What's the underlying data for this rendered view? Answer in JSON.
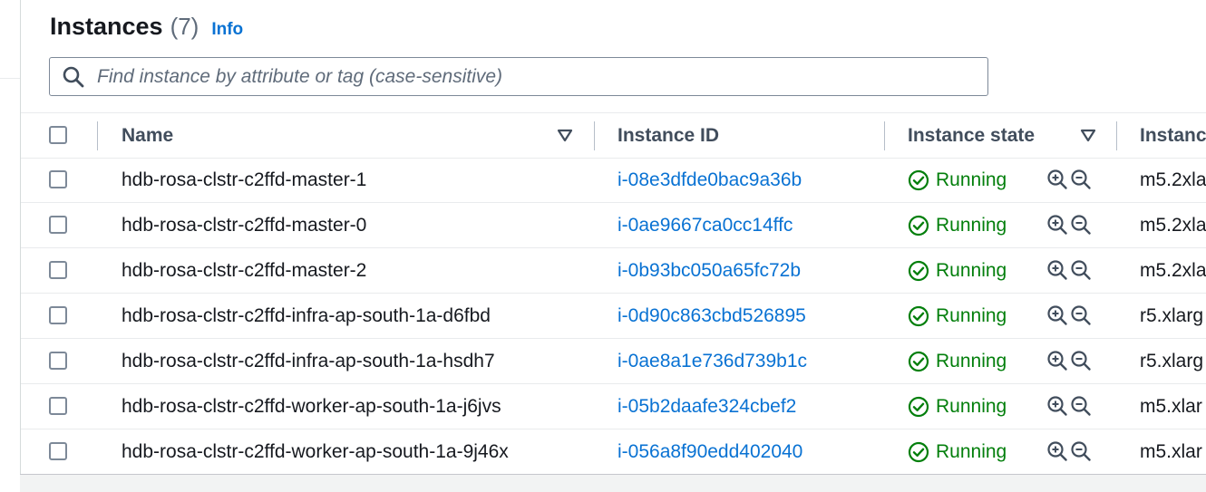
{
  "header": {
    "title": "Instances",
    "count": "(7)",
    "info_link": "Info"
  },
  "search": {
    "placeholder": "Find instance by attribute or tag (case-sensitive)"
  },
  "columns": {
    "name": "Name",
    "instance_id": "Instance ID",
    "instance_state": "Instance state",
    "instance_type": "Instanc"
  },
  "rows": [
    {
      "name": "hdb-rosa-clstr-c2ffd-master-1",
      "id": "i-08e3dfde0bac9a36b",
      "state": "Running",
      "type": "m5.2xla"
    },
    {
      "name": "hdb-rosa-clstr-c2ffd-master-0",
      "id": "i-0ae9667ca0cc14ffc",
      "state": "Running",
      "type": "m5.2xla"
    },
    {
      "name": "hdb-rosa-clstr-c2ffd-master-2",
      "id": "i-0b93bc050a65fc72b",
      "state": "Running",
      "type": "m5.2xla"
    },
    {
      "name": "hdb-rosa-clstr-c2ffd-infra-ap-south-1a-d6fbd",
      "id": "i-0d90c863cbd526895",
      "state": "Running",
      "type": "r5.xlarg"
    },
    {
      "name": "hdb-rosa-clstr-c2ffd-infra-ap-south-1a-hsdh7",
      "id": "i-0ae8a1e736d739b1c",
      "state": "Running",
      "type": "r5.xlarg"
    },
    {
      "name": "hdb-rosa-clstr-c2ffd-worker-ap-south-1a-j6jvs",
      "id": "i-05b2daafe324cbef2",
      "state": "Running",
      "type": "m5.xlar"
    },
    {
      "name": "hdb-rosa-clstr-c2ffd-worker-ap-south-1a-9j46x",
      "id": "i-056a8f90edd402040",
      "state": "Running",
      "type": "m5.xlar"
    }
  ],
  "colors": {
    "link": "#0972d3",
    "running": "#037f0c",
    "text": "#16191f",
    "header_text": "#414d5c"
  }
}
